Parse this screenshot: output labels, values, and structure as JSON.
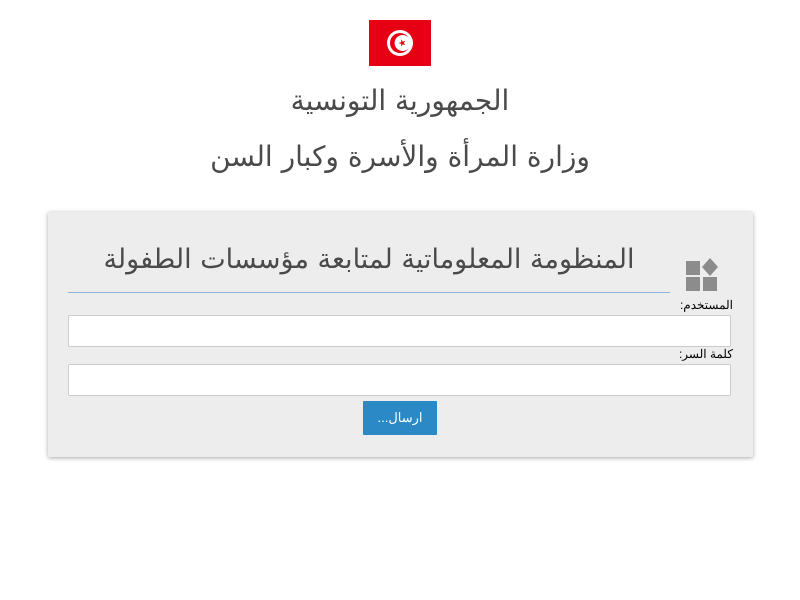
{
  "header": {
    "flag_icon": "tunisia-flag-icon",
    "republic_title": "الجمهورية التونسية",
    "ministry_title": "وزارة المرأة والأسرة وكبار السن"
  },
  "login": {
    "app_icon": "widgets-icon",
    "title": "المنظومة المعلوماتية لمتابعة مؤسسات الطفولة",
    "username_label": "المستخدم:",
    "username_value": "",
    "password_label": "كلمة السر:",
    "password_value": "",
    "submit_label": "ارسال..."
  },
  "colors": {
    "flag_red": "#e70013",
    "button_blue": "#2b89c6",
    "card_background": "#ededed",
    "title_underline": "#8fb4d9",
    "icon_gray": "#8c8c8c"
  }
}
